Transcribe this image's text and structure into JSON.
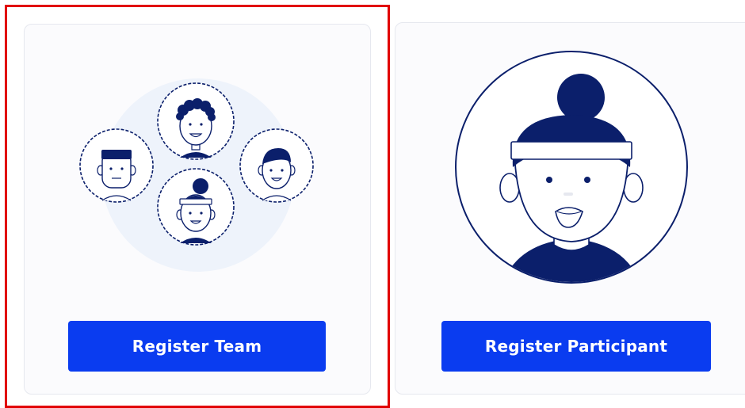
{
  "theme": {
    "accent": "#0a3cf0",
    "navy": "#0b1f6b",
    "selection_outline": "#e10000",
    "card_background": "#fbfbfd",
    "illustration_backdrop": "#eef3fb"
  },
  "cards": [
    {
      "id": "team",
      "selected": true,
      "illustration_icon": "team-avatars-icon",
      "button_label": "Register Team"
    },
    {
      "id": "participant",
      "selected": false,
      "illustration_icon": "participant-avatar-icon",
      "button_label": "Register Participant"
    }
  ]
}
